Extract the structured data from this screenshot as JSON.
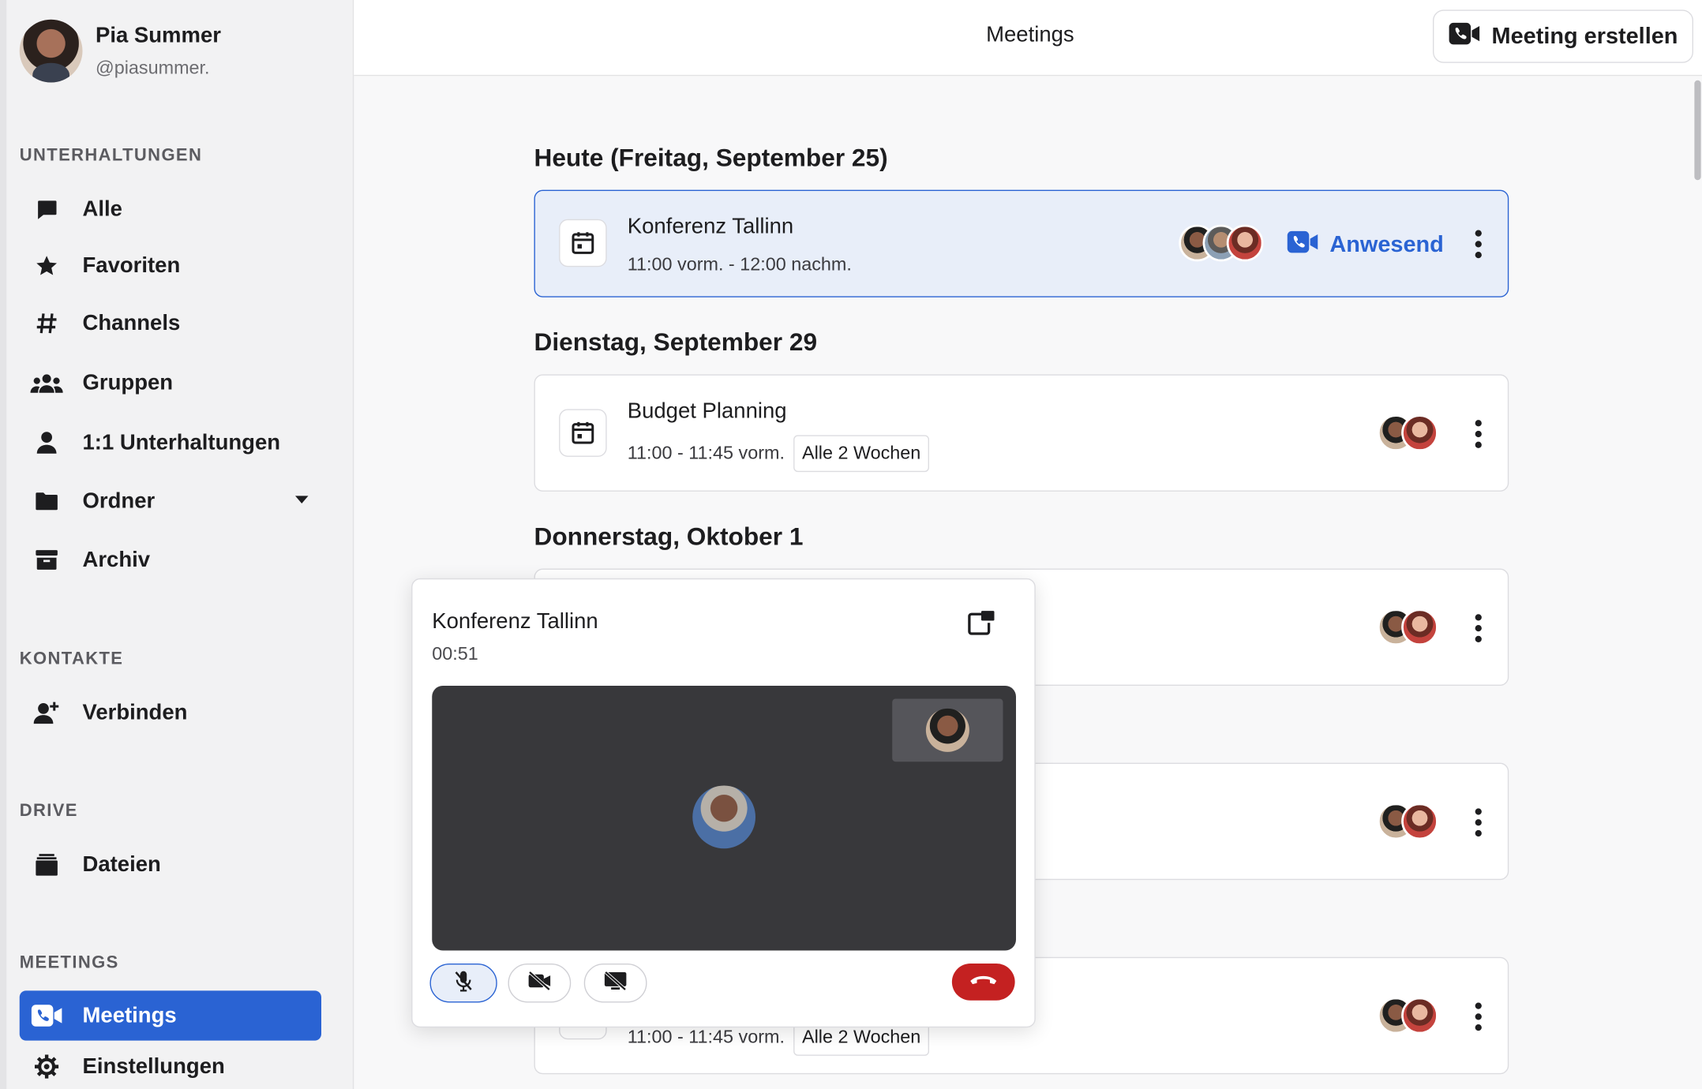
{
  "profile": {
    "name": "Pia Summer",
    "handle": "@piasummer."
  },
  "sidebar": {
    "sections": {
      "conversations": "UNTERHALTUNGEN",
      "contacts": "KONTAKTE",
      "drive": "DRIVE",
      "meetings": "MEETINGS"
    },
    "items": [
      {
        "label": "Alle",
        "icon": "chat-bubble-icon"
      },
      {
        "label": "Favoriten",
        "icon": "star-icon"
      },
      {
        "label": "Channels",
        "icon": "hash-icon"
      },
      {
        "label": "Gruppen",
        "icon": "group-icon"
      },
      {
        "label": "1:1 Unterhaltungen",
        "icon": "person-icon"
      },
      {
        "label": "Ordner",
        "icon": "folder-icon"
      },
      {
        "label": "Archiv",
        "icon": "archive-icon"
      },
      {
        "label": "Verbinden",
        "icon": "add-person-icon"
      },
      {
        "label": "Dateien",
        "icon": "files-icon"
      },
      {
        "label": "Meetings",
        "icon": "video-call-icon",
        "active": true
      },
      {
        "label": "Einstellungen",
        "icon": "gear-icon"
      }
    ]
  },
  "header": {
    "title": "Meetings",
    "create_label": "Meeting erstellen"
  },
  "days": [
    {
      "label": "Heute (Freitag, September 25)"
    },
    {
      "label": "Dienstag, September 29"
    },
    {
      "label": "Donnerstag, Oktober 1"
    }
  ],
  "meetings": [
    {
      "title": "Konferenz Tallinn",
      "time": "11:00 vorm. - 12:00 nachm.",
      "action": "Anwesend",
      "participants": 3
    },
    {
      "title": "Budget Planning",
      "time": "11:00 - 11:45 vorm.",
      "badge": "Alle 2 Wochen",
      "participants": 2
    },
    {
      "participants": 2
    },
    {
      "participants": 2
    },
    {
      "time": "11:00 - 11:45 vorm.",
      "badge": "Alle 2 Wochen",
      "participants": 2
    }
  ],
  "call": {
    "title": "Konferenz Tallinn",
    "timer": "00:51"
  },
  "colors": {
    "accent": "#2a63d3",
    "hangup": "#c42121",
    "video_bg": "#38383b"
  }
}
